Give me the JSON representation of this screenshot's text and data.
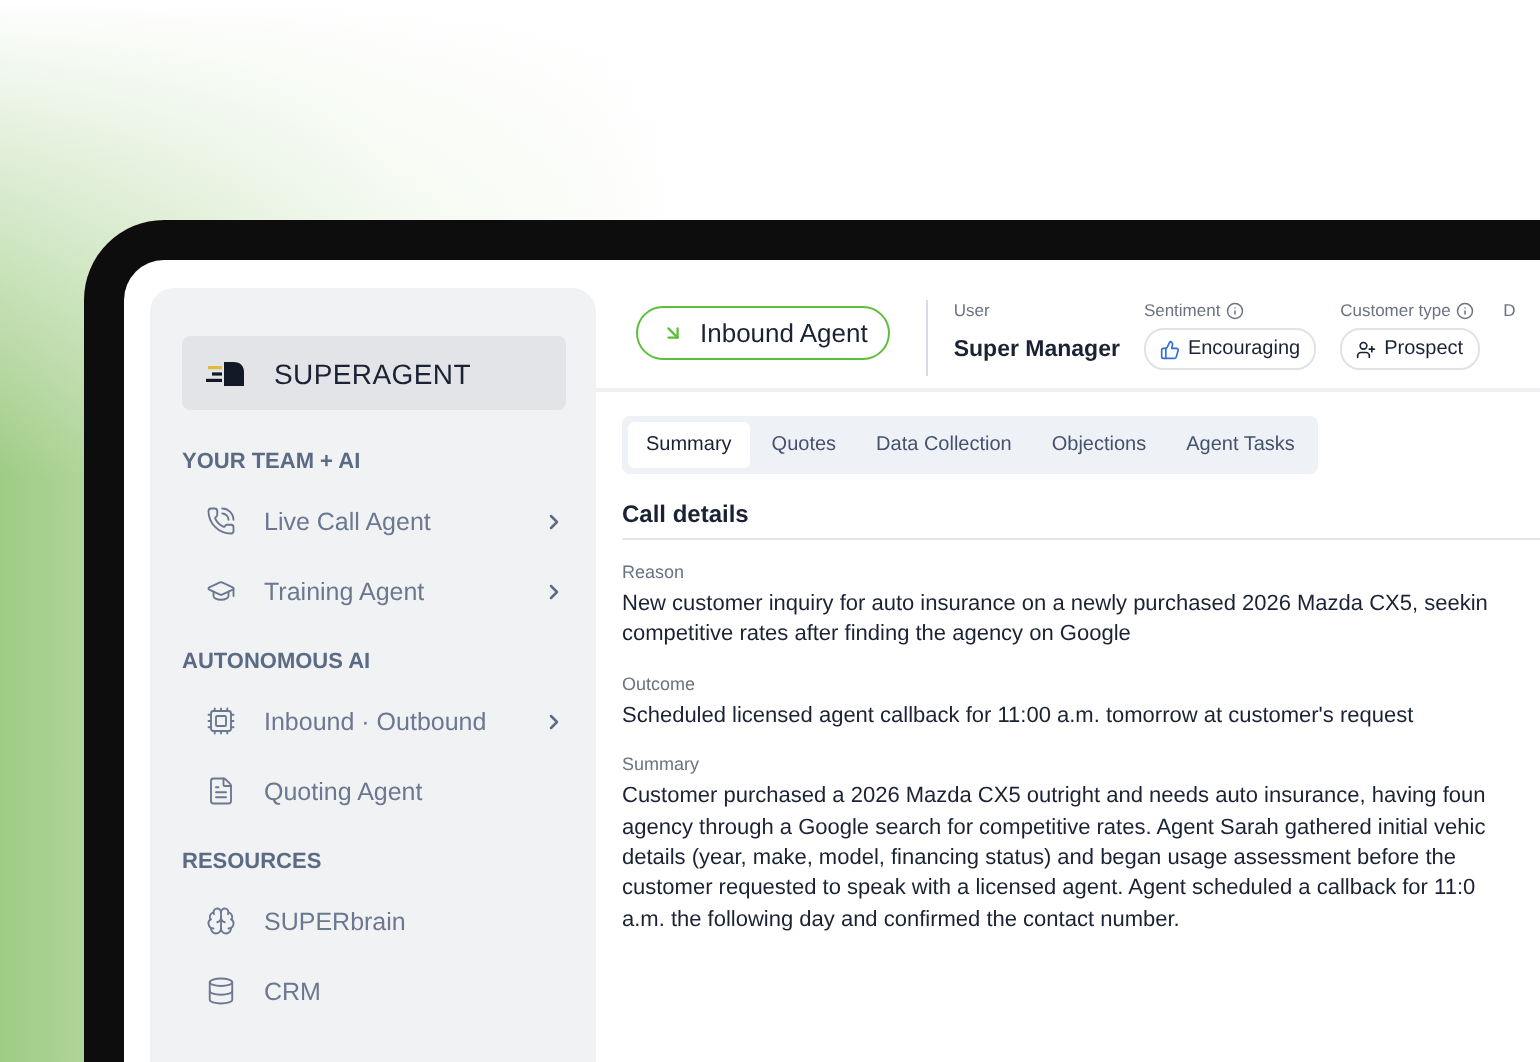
{
  "brand": {
    "name": "SUPERAGENT"
  },
  "sidebar": {
    "sections": [
      {
        "heading": "YOUR TEAM + AI",
        "items": [
          {
            "label": "Live Call Agent",
            "kind": "phone",
            "expandable": true
          },
          {
            "label": "Training Agent",
            "kind": "training",
            "expandable": true
          }
        ]
      },
      {
        "heading": "AUTONOMOUS AI",
        "items": [
          {
            "label": "Inbound · Outbound",
            "kind": "chip",
            "expandable": true
          },
          {
            "label": "Quoting Agent",
            "kind": "document",
            "expandable": false
          }
        ]
      },
      {
        "heading": "RESOURCES",
        "items": [
          {
            "label": "SUPERbrain",
            "kind": "brain",
            "expandable": false
          },
          {
            "label": "CRM",
            "kind": "database",
            "expandable": false
          }
        ]
      }
    ]
  },
  "header": {
    "agent": "Inbound Agent",
    "fields": [
      {
        "kind": "text",
        "label": "User",
        "value": "Super Manager"
      },
      {
        "kind": "sentiment",
        "label": "Sentiment",
        "value": "Encouraging"
      },
      {
        "kind": "customer",
        "label": "Customer type",
        "value": "Prospect"
      },
      {
        "kind": "label",
        "label": "D"
      }
    ]
  },
  "tabs": [
    {
      "label": "Summary",
      "selected": true
    },
    {
      "label": "Quotes",
      "selected": false
    },
    {
      "label": "Data Collection",
      "selected": false
    },
    {
      "label": "Objections",
      "selected": false
    },
    {
      "label": "Agent Tasks",
      "selected": false
    }
  ],
  "call_details": {
    "title": "Call details",
    "sections": [
      {
        "label": "Reason",
        "text": "New customer inquiry for auto insurance on a newly purchased 2026 Mazda CX5, seekin\ncompetitive rates after finding the agency on Google"
      },
      {
        "label": "Outcome",
        "text": "Scheduled licensed agent callback for 11:00 a.m. tomorrow at customer's request"
      },
      {
        "label": "Summary",
        "text": "Customer purchased a 2026 Mazda CX5 outright and needs auto insurance, having foun\nagency through a Google search for competitive rates. Agent Sarah gathered initial vehic\ndetails (year, make, model, financing status) and began usage assessment before the\ncustomer requested to speak with a licensed agent. Agent scheduled a callback for 11:0\na.m. the following day and confirmed the contact number."
      }
    ]
  }
}
